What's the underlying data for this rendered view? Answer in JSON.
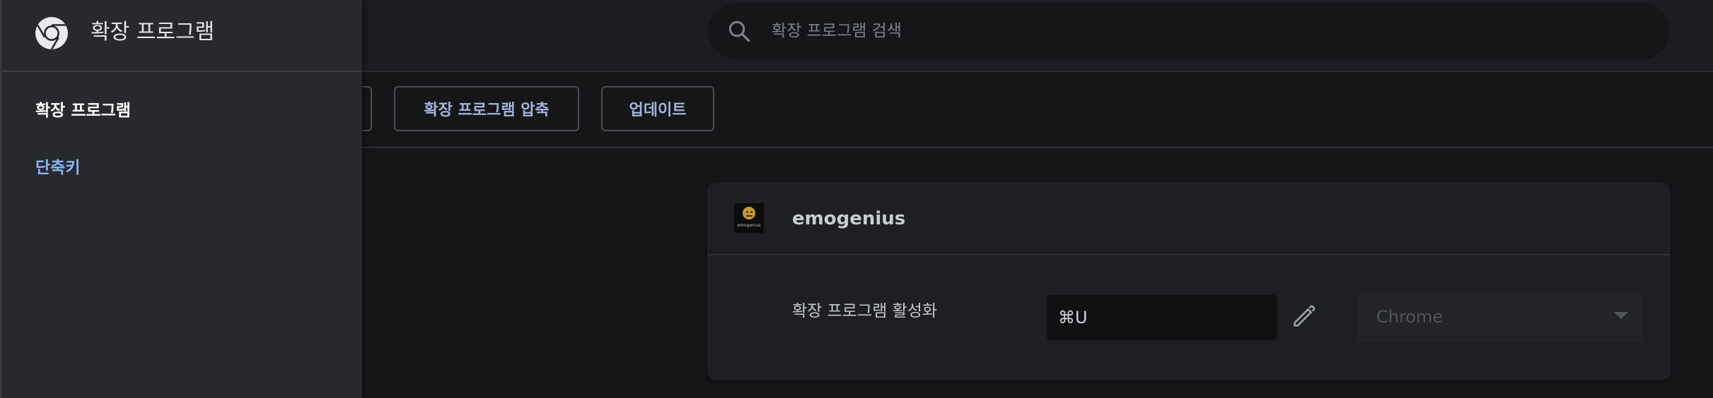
{
  "drawer": {
    "title": "확장 프로그램",
    "items": [
      {
        "label": "확장 프로그램",
        "active": false
      },
      {
        "label": "단축키",
        "active": true
      }
    ]
  },
  "search": {
    "placeholder": "확장 프로그램 검색",
    "value": ""
  },
  "toolbar": {
    "pack_label": "확장 프로그램 압축",
    "update_label": "업데이트"
  },
  "extension": {
    "name": "emogenius",
    "icon_text": "emogenius",
    "shortcut_label": "확장 프로그램 활성화",
    "shortcut_value": "⌘U",
    "scope": "Chrome"
  },
  "icons": {
    "logo": "chrome-logo-icon",
    "search": "search-icon",
    "edit": "pencil-icon",
    "dropdown": "dropdown-arrow-icon"
  },
  "colors": {
    "link_blue": "#8ab4f8",
    "button_text": "#a4b4da",
    "drawer_bg": "#28292d",
    "page_bg": "#151618"
  }
}
